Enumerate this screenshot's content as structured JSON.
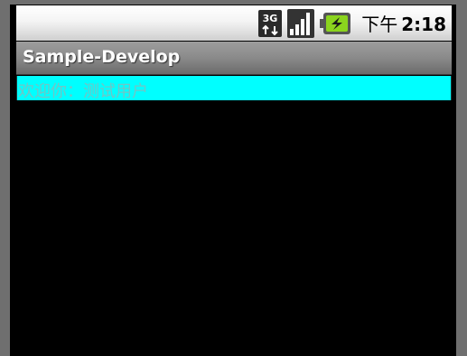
{
  "status_bar": {
    "network_label": "3G",
    "icons": [
      "network-3g-icon",
      "signal-strength-icon",
      "battery-charging-icon"
    ],
    "clock_am_pm": "下午",
    "clock_time": "2:18"
  },
  "title_bar": {
    "app_title": "Sample-Develop"
  },
  "content": {
    "welcome_text": "欢迎你：测试用户"
  },
  "colors": {
    "welcome_background": "#00ffff",
    "welcome_text": "#6fc6c6",
    "screen_background": "#000000",
    "battery_green": "#8bd41e"
  }
}
